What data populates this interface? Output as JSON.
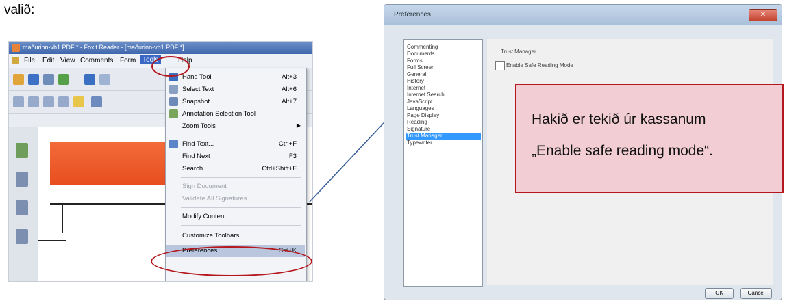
{
  "caption": "valið:",
  "foxit": {
    "window_title": "maðurinn-vb1.PDF * - Foxit Reader - [maðurinn-vb1.PDF *]",
    "menus": [
      "File",
      "Edit",
      "View",
      "Comments",
      "Form",
      "Tools",
      "Help"
    ],
    "tools_menu": [
      {
        "label": "Hand Tool",
        "shortcut": "Alt+3",
        "icon": "hand-icon"
      },
      {
        "label": "Select Text",
        "shortcut": "Alt+6",
        "icon": "select-text-icon"
      },
      {
        "label": "Snapshot",
        "shortcut": "Alt+7",
        "icon": "camera-icon"
      },
      {
        "label": "Annotation Selection Tool",
        "shortcut": "",
        "icon": "annotation-icon"
      },
      {
        "label": "Zoom Tools",
        "shortcut": "",
        "icon": "",
        "submenu": true
      },
      {
        "label": "Find Text...",
        "shortcut": "Ctrl+F",
        "icon": "find-icon"
      },
      {
        "label": "Find Next",
        "shortcut": "F3",
        "icon": ""
      },
      {
        "label": "Search...",
        "shortcut": "Ctrl+Shift+F",
        "icon": ""
      },
      {
        "label": "Sign Document",
        "shortcut": "",
        "icon": "",
        "disabled": true
      },
      {
        "label": "Validate All Signatures",
        "shortcut": "",
        "icon": "",
        "disabled": true
      },
      {
        "label": "Modify Content...",
        "shortcut": "",
        "icon": ""
      },
      {
        "label": "Customize Toolbars...",
        "shortcut": "",
        "icon": ""
      },
      {
        "label": "Preferences...",
        "shortcut": "Ctrl+K",
        "icon": "",
        "highlighted": true
      }
    ]
  },
  "preferences": {
    "title": "Preferences",
    "categories": [
      "Commenting",
      "Documents",
      "Forms",
      "Full Screen",
      "General",
      "History",
      "Internet",
      "Internet Search",
      "JavaScript",
      "Languages",
      "Page Display",
      "Reading",
      "Signature",
      "Trust Manager",
      "Typewriter"
    ],
    "selected_category": "Trust Manager",
    "group_label": "Trust Manager",
    "checkbox_label": "Enable Safe Reading Mode",
    "checkbox_checked": false,
    "ok_label": "OK",
    "cancel_label": "Cancel"
  },
  "note": {
    "line1": "Hakið er tekið úr kassanum",
    "line2": "„Enable safe reading mode“."
  },
  "colors": {
    "annotation_red": "#b4171d",
    "arrow_blue": "#3b5f9a",
    "note_fill": "#f2ced4",
    "selection_blue": "#3399ff"
  }
}
